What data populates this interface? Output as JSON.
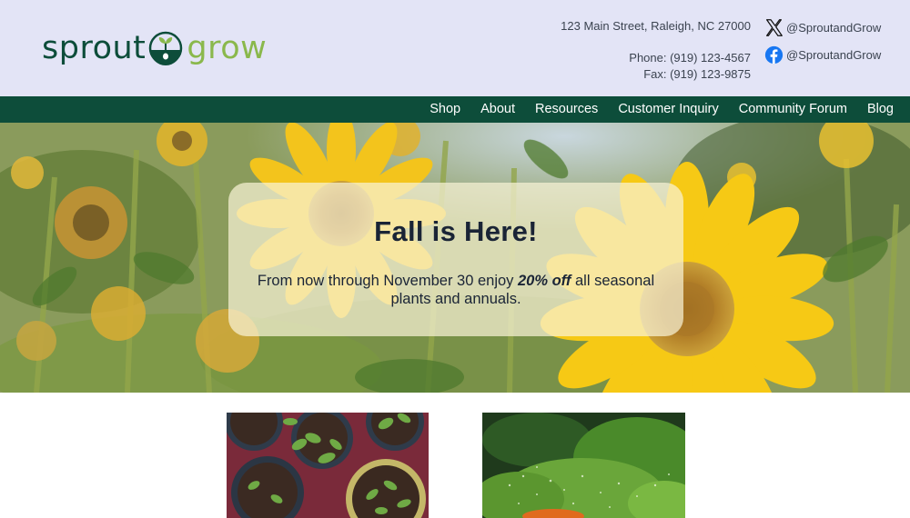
{
  "brand": {
    "name_part1": "sprout",
    "name_part2": "grow"
  },
  "contact": {
    "address": "123 Main Street, Raleigh, NC 27000",
    "phone": "Phone: (919) 123-4567",
    "fax": "Fax: (919) 123-9875"
  },
  "social": {
    "x_handle": "@SproutandGrow",
    "facebook_handle": "@SproutandGrow"
  },
  "nav": {
    "items": [
      "Shop",
      "About",
      "Resources",
      "Customer Inquiry",
      "Community Forum",
      "Blog"
    ]
  },
  "hero": {
    "title": "Fall is Here!",
    "text_before": "From now through November 30 enjoy ",
    "text_emphasis": "20% off",
    "text_after": " all seasonal plants and annuals."
  },
  "colors": {
    "header_bg": "#e3e4f6",
    "brand_dark_green": "#0d4d3a",
    "brand_light_green": "#8ab84c",
    "hero_card": "#f8f2d6"
  },
  "icons": {
    "x": "x-logo-icon",
    "facebook": "facebook-logo-icon",
    "logo_mark": "seedling-logo-icon"
  }
}
